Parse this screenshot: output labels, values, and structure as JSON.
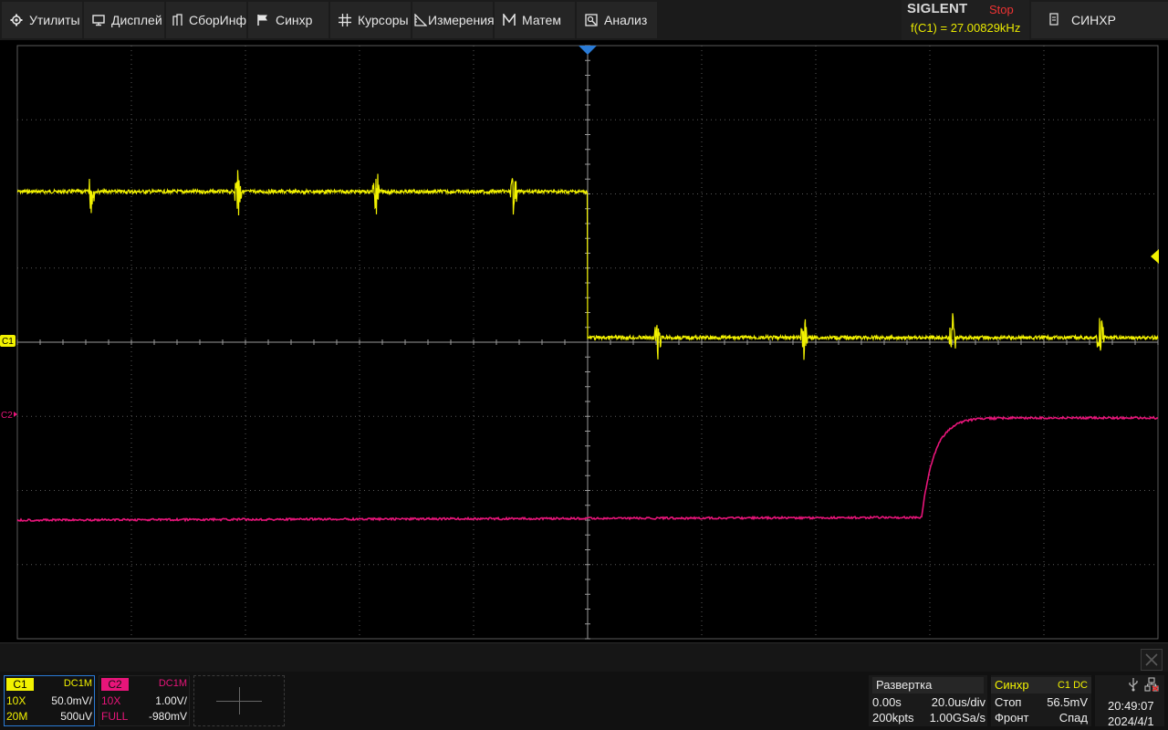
{
  "menu": {
    "items": [
      {
        "label": "Утилиты",
        "icon": "gear-icon"
      },
      {
        "label": "Дисплей",
        "icon": "monitor-icon"
      },
      {
        "label": "СборИнф",
        "icon": "acquire-icon"
      },
      {
        "label": "Синхр",
        "icon": "flag-icon"
      },
      {
        "label": "Курсоры",
        "icon": "cursor-grid-icon"
      },
      {
        "label": "Измерения",
        "icon": "measure-icon"
      },
      {
        "label": "Матем",
        "icon": "math-icon"
      },
      {
        "label": "Анализ",
        "icon": "analysis-icon"
      }
    ],
    "trigger_menu_label": "СИНХР"
  },
  "brand": {
    "logo": "SIGLENT",
    "run_state": "Stop",
    "frequency": "f(C1) = 27.00829kHz"
  },
  "markers": {
    "ch1": "C1",
    "ch2": "C2"
  },
  "colors": {
    "ch1": "#f2f200",
    "ch2": "#e8157a",
    "grid": "#5a5a5a",
    "trigger": "#2a7bd6",
    "stop": "#e33333"
  },
  "channels": [
    {
      "tag": "C1",
      "coupling": "DC1M",
      "probe": "10X",
      "scale": "50.0mV/",
      "bandwidth": "20M",
      "offset": "500uV"
    },
    {
      "tag": "C2",
      "coupling": "DC1M",
      "probe": "10X",
      "scale": "1.00V/",
      "bandwidth": "FULL",
      "offset": "-980mV"
    }
  ],
  "timebase": {
    "title": "Развертка",
    "delay": "0.00s",
    "scale": "20.0us/div",
    "memory": "200kpts",
    "sample_rate": "1.00GSa/s"
  },
  "trigger": {
    "title": "Синхр",
    "source": "C1 DC",
    "mode": "Стоп",
    "level": "56.5mV",
    "type": "Фронт",
    "slope": "Спад"
  },
  "clock": {
    "time": "20:49:07",
    "date": "2024/4/1"
  }
}
